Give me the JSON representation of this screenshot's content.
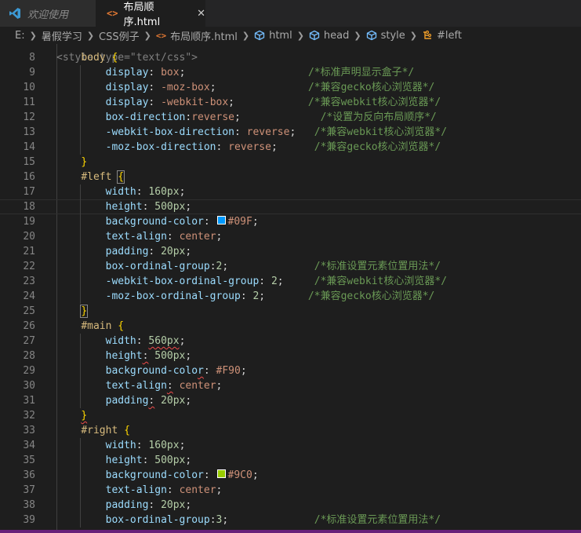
{
  "tabs": [
    {
      "label": "欢迎使用"
    },
    {
      "label": "布局顺序.html"
    }
  ],
  "breadcrumb": [
    "E:",
    "暑假学习",
    "CSS例子",
    "布局顺序.html",
    "html",
    "head",
    "style",
    "#left"
  ],
  "colors": {
    "swatch_09F": "#0099ff",
    "swatch_9C0": "#99cc00",
    "accent": "#68217a"
  },
  "icons": {
    "logo": "vscode-logo-icon",
    "file": "html-file-icon",
    "element": "cube-icon",
    "selector": "css-selector-icon",
    "close": "close-icon",
    "chevron": "chevron-right-icon"
  },
  "code": {
    "partial_top": "<style type=\"text/css\">",
    "lines": [
      {
        "n": "8",
        "tokens": [
          [
            "    ",
            ""
          ],
          [
            "body",
            "sel"
          ],
          [
            " ",
            ""
          ],
          [
            "{",
            "brace"
          ]
        ]
      },
      {
        "n": "9",
        "tokens": [
          [
            "        ",
            ""
          ],
          [
            "display",
            "prop"
          ],
          [
            ": ",
            "punc"
          ],
          [
            "box",
            "val"
          ],
          [
            ";",
            "punc"
          ],
          [
            "                    ",
            ""
          ],
          [
            "/*标准声明显示盒子*/",
            "com"
          ]
        ]
      },
      {
        "n": "10",
        "tokens": [
          [
            "        ",
            ""
          ],
          [
            "display",
            "prop"
          ],
          [
            ": ",
            "punc"
          ],
          [
            "-moz-box",
            "val"
          ],
          [
            ";",
            "punc"
          ],
          [
            "               ",
            ""
          ],
          [
            "/*兼容gecko核心浏览器*/",
            "com"
          ]
        ]
      },
      {
        "n": "11",
        "tokens": [
          [
            "        ",
            ""
          ],
          [
            "display",
            "prop"
          ],
          [
            ": ",
            "punc"
          ],
          [
            "-webkit-box",
            "val"
          ],
          [
            ";",
            "punc"
          ],
          [
            "            ",
            ""
          ],
          [
            "/*兼容webkit核心浏览器*/",
            "com"
          ]
        ]
      },
      {
        "n": "12",
        "tokens": [
          [
            "        ",
            ""
          ],
          [
            "box-direction",
            "prop"
          ],
          [
            ":",
            "punc"
          ],
          [
            "reverse",
            "val"
          ],
          [
            ";",
            "punc"
          ],
          [
            "             ",
            ""
          ],
          [
            "/*设置为反向布局顺序*/",
            "com"
          ]
        ]
      },
      {
        "n": "13",
        "tokens": [
          [
            "        ",
            ""
          ],
          [
            "-webkit-box-direction",
            "prop"
          ],
          [
            ": ",
            "punc"
          ],
          [
            "reverse",
            "val"
          ],
          [
            ";",
            "punc"
          ],
          [
            "   ",
            ""
          ],
          [
            "/*兼容webkit核心浏览器*/",
            "com"
          ]
        ]
      },
      {
        "n": "14",
        "tokens": [
          [
            "        ",
            ""
          ],
          [
            "-moz-box-direction",
            "prop"
          ],
          [
            ": ",
            "punc"
          ],
          [
            "reverse",
            "val"
          ],
          [
            ";",
            "punc"
          ],
          [
            "      ",
            ""
          ],
          [
            "/*兼容gecko核心浏览器*/",
            "com"
          ]
        ]
      },
      {
        "n": "15",
        "tokens": [
          [
            "    ",
            ""
          ],
          [
            "}",
            "brace"
          ]
        ]
      },
      {
        "n": "16",
        "tokens": [
          [
            "    ",
            ""
          ],
          [
            "#left",
            "sel"
          ],
          [
            " ",
            ""
          ],
          [
            "{",
            "brace-match"
          ]
        ]
      },
      {
        "n": "17",
        "tokens": [
          [
            "        ",
            ""
          ],
          [
            "width",
            "prop"
          ],
          [
            ": ",
            "punc"
          ],
          [
            "160px",
            "num"
          ],
          [
            ";",
            "punc"
          ]
        ]
      },
      {
        "n": "18",
        "tokens": [
          [
            "        ",
            ""
          ],
          [
            "height",
            "prop"
          ],
          [
            ": ",
            "punc"
          ],
          [
            "500px",
            "num"
          ],
          [
            ";",
            "punc"
          ]
        ],
        "current": true
      },
      {
        "n": "19",
        "tokens": [
          [
            "        ",
            ""
          ],
          [
            "background-color",
            "prop"
          ],
          [
            ": ",
            "punc"
          ],
          [
            "@swatch_09F",
            "swatch"
          ],
          [
            "#09F",
            "val"
          ],
          [
            ";",
            "punc"
          ]
        ]
      },
      {
        "n": "20",
        "tokens": [
          [
            "        ",
            ""
          ],
          [
            "text-align",
            "prop"
          ],
          [
            ": ",
            "punc"
          ],
          [
            "center",
            "val"
          ],
          [
            ";",
            "punc"
          ]
        ]
      },
      {
        "n": "21",
        "tokens": [
          [
            "        ",
            ""
          ],
          [
            "padding",
            "prop"
          ],
          [
            ": ",
            "punc"
          ],
          [
            "20px",
            "num"
          ],
          [
            ";",
            "punc"
          ]
        ]
      },
      {
        "n": "22",
        "tokens": [
          [
            "        ",
            ""
          ],
          [
            "box-ordinal-group",
            "prop"
          ],
          [
            ":",
            "punc"
          ],
          [
            "2",
            "num"
          ],
          [
            ";",
            "punc"
          ],
          [
            "              ",
            ""
          ],
          [
            "/*标准设置元素位置用法*/",
            "com"
          ]
        ]
      },
      {
        "n": "23",
        "tokens": [
          [
            "        ",
            ""
          ],
          [
            "-webkit-box-ordinal-group",
            "prop"
          ],
          [
            ": ",
            "punc"
          ],
          [
            "2",
            "num"
          ],
          [
            ";",
            "punc"
          ],
          [
            "     ",
            ""
          ],
          [
            "/*兼容webkit核心浏览器*/",
            "com"
          ]
        ]
      },
      {
        "n": "24",
        "tokens": [
          [
            "        ",
            ""
          ],
          [
            "-moz-box-ordinal-group",
            "prop"
          ],
          [
            ": ",
            "punc"
          ],
          [
            "2",
            "num"
          ],
          [
            ";",
            "punc"
          ],
          [
            "       ",
            ""
          ],
          [
            "/*兼容gecko核心浏览器*/",
            "com"
          ]
        ]
      },
      {
        "n": "25",
        "tokens": [
          [
            "    ",
            ""
          ],
          [
            "}",
            "brace-match"
          ]
        ]
      },
      {
        "n": "26",
        "tokens": [
          [
            "    ",
            ""
          ],
          [
            "#main",
            "sel"
          ],
          [
            " ",
            ""
          ],
          [
            "{",
            "brace"
          ]
        ]
      },
      {
        "n": "27",
        "tokens": [
          [
            "        ",
            ""
          ],
          [
            "width",
            "prop"
          ],
          [
            ": ",
            "punc"
          ],
          [
            "560px",
            "num-squig"
          ],
          [
            ";",
            "punc"
          ]
        ]
      },
      {
        "n": "28",
        "tokens": [
          [
            "        ",
            ""
          ],
          [
            "height",
            "prop"
          ],
          [
            ":",
            "punc-squig"
          ],
          [
            " ",
            ""
          ],
          [
            "500px",
            "num"
          ],
          [
            ";",
            "punc"
          ]
        ]
      },
      {
        "n": "29",
        "tokens": [
          [
            "        ",
            ""
          ],
          [
            "background-colo",
            "prop"
          ],
          [
            "r",
            "prop-squig"
          ],
          [
            ": ",
            "punc"
          ],
          [
            "#F90",
            "val"
          ],
          [
            ";",
            "punc"
          ]
        ]
      },
      {
        "n": "30",
        "tokens": [
          [
            "        ",
            ""
          ],
          [
            "text-align",
            "prop"
          ],
          [
            ":",
            "punc-squig"
          ],
          [
            " ",
            ""
          ],
          [
            "center",
            "val"
          ],
          [
            ";",
            "punc"
          ]
        ]
      },
      {
        "n": "31",
        "tokens": [
          [
            "        ",
            ""
          ],
          [
            "padding",
            "prop"
          ],
          [
            ":",
            "punc-squig"
          ],
          [
            " ",
            ""
          ],
          [
            "20px",
            "num"
          ],
          [
            ";",
            "punc"
          ]
        ]
      },
      {
        "n": "32",
        "tokens": [
          [
            "    ",
            ""
          ],
          [
            "}",
            "brace-squig"
          ]
        ]
      },
      {
        "n": "33",
        "tokens": [
          [
            "    ",
            ""
          ],
          [
            "#right",
            "sel"
          ],
          [
            " ",
            ""
          ],
          [
            "{",
            "brace"
          ]
        ]
      },
      {
        "n": "34",
        "tokens": [
          [
            "        ",
            ""
          ],
          [
            "width",
            "prop"
          ],
          [
            ": ",
            "punc"
          ],
          [
            "160px",
            "num"
          ],
          [
            ";",
            "punc"
          ]
        ]
      },
      {
        "n": "35",
        "tokens": [
          [
            "        ",
            ""
          ],
          [
            "height",
            "prop"
          ],
          [
            ": ",
            "punc"
          ],
          [
            "500px",
            "num"
          ],
          [
            ";",
            "punc"
          ]
        ]
      },
      {
        "n": "36",
        "tokens": [
          [
            "        ",
            ""
          ],
          [
            "background-color",
            "prop"
          ],
          [
            ": ",
            "punc"
          ],
          [
            "@swatch_9C0",
            "swatch"
          ],
          [
            "#9C0",
            "val"
          ],
          [
            ";",
            "punc"
          ]
        ]
      },
      {
        "n": "37",
        "tokens": [
          [
            "        ",
            ""
          ],
          [
            "text-align",
            "prop"
          ],
          [
            ": ",
            "punc"
          ],
          [
            "center",
            "val"
          ],
          [
            ";",
            "punc"
          ]
        ]
      },
      {
        "n": "38",
        "tokens": [
          [
            "        ",
            ""
          ],
          [
            "padding",
            "prop"
          ],
          [
            ": ",
            "punc"
          ],
          [
            "20px",
            "num"
          ],
          [
            ";",
            "punc"
          ]
        ]
      },
      {
        "n": "39",
        "tokens": [
          [
            "        ",
            ""
          ],
          [
            "box-ordinal-group",
            "prop"
          ],
          [
            ":",
            "punc"
          ],
          [
            "3",
            "num"
          ],
          [
            ";",
            "punc"
          ],
          [
            "              ",
            ""
          ],
          [
            "/*标准设置元素位置用法*/",
            "com"
          ]
        ]
      }
    ]
  }
}
